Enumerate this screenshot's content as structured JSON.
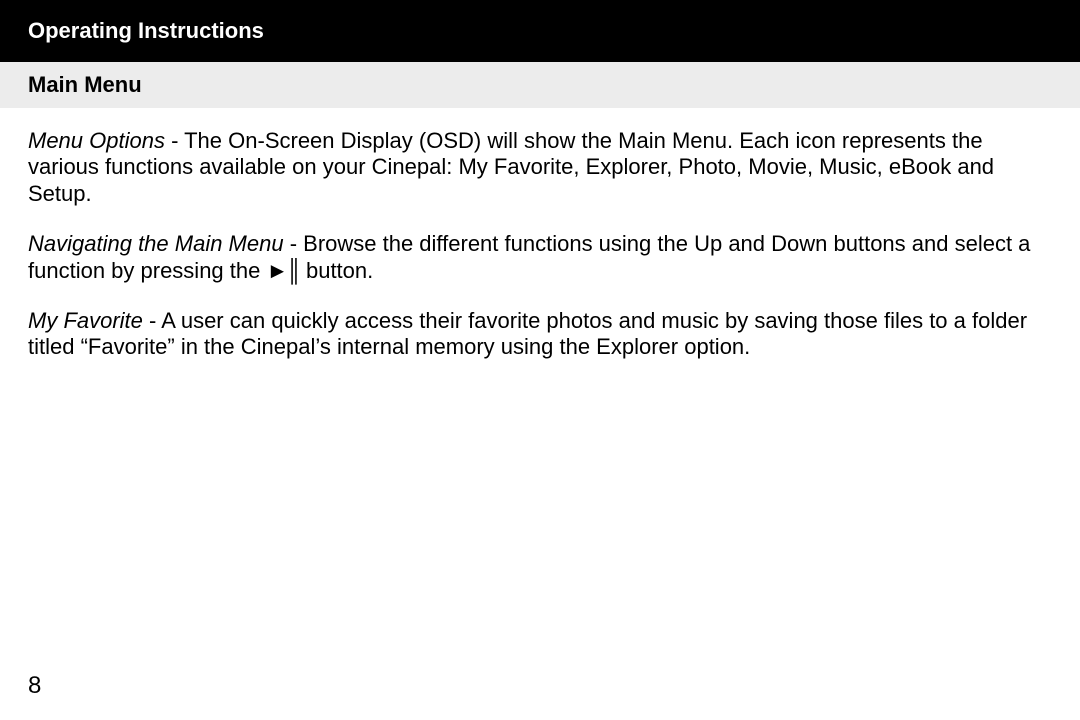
{
  "header": {
    "title": "Operating Instructions"
  },
  "subheader": {
    "title": "Main Menu"
  },
  "paragraphs": {
    "p1_lead": "Menu Options",
    "p1_rest": " - The On-Screen Display (OSD) will show the Main Menu. Each icon repre­sents the various functions available on your Cinepal: My Favorite, Explorer, Photo, Movie, Music, eBook and Setup.",
    "p2_lead": "Navigating the Main Menu",
    "p2_rest_a": " - Browse the different functions using the Up and Down buttons and select a function by pressing the  ",
    "p2_symbol": "►║",
    "p2_rest_b": "  button.",
    "p3_lead": "My Favorite",
    "p3_rest": " - A user can quickly access their favorite photos and music by saving those files to a folder titled “Favorite” in the Cinepal’s internal memory using the Explorer option."
  },
  "page_number": "8"
}
